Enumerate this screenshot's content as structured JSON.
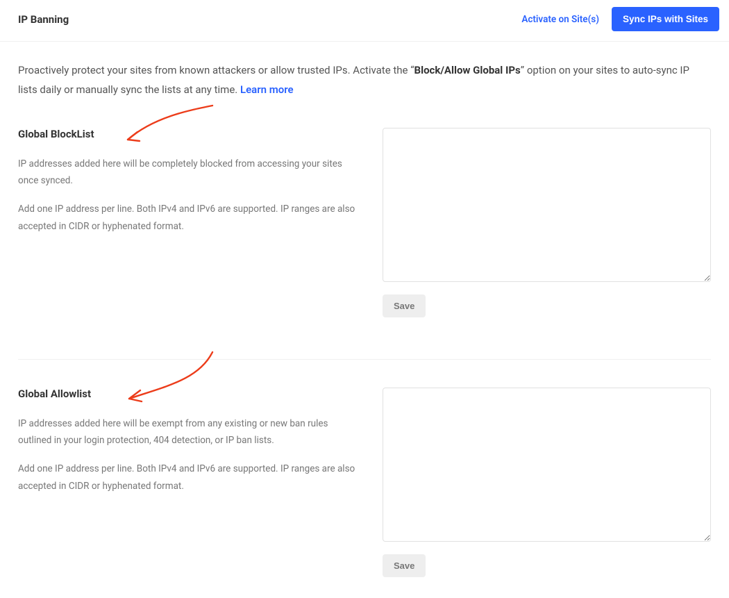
{
  "header": {
    "title": "IP Banning",
    "activate_label": "Activate on Site(s)",
    "sync_label": "Sync IPs with Sites"
  },
  "intro": {
    "pre": "Proactively protect your sites from known attackers or allow trusted IPs. Activate the “",
    "strong": "Block/Allow Global IPs",
    "post": "” option on your sites to auto-sync IP lists daily or manually sync the lists at any time. ",
    "learn_more": "Learn more"
  },
  "blocklist": {
    "title": "Global BlockList",
    "desc1": "IP addresses added here will be completely blocked from accessing your sites once synced.",
    "desc2": "Add one IP address per line. Both IPv4 and IPv6 are supported. IP ranges are also accepted in CIDR or hyphenated format.",
    "value": "",
    "save_label": "Save"
  },
  "allowlist": {
    "title": "Global Allowlist",
    "desc1": "IP addresses added here will be exempt from any existing or new ban rules outlined in your login protection, 404 detection, or IP ban lists.",
    "desc2": "Add one IP address per line. Both IPv4 and IPv6 are supported. IP ranges are also accepted in CIDR or hyphenated format.",
    "value": "",
    "save_label": "Save"
  }
}
